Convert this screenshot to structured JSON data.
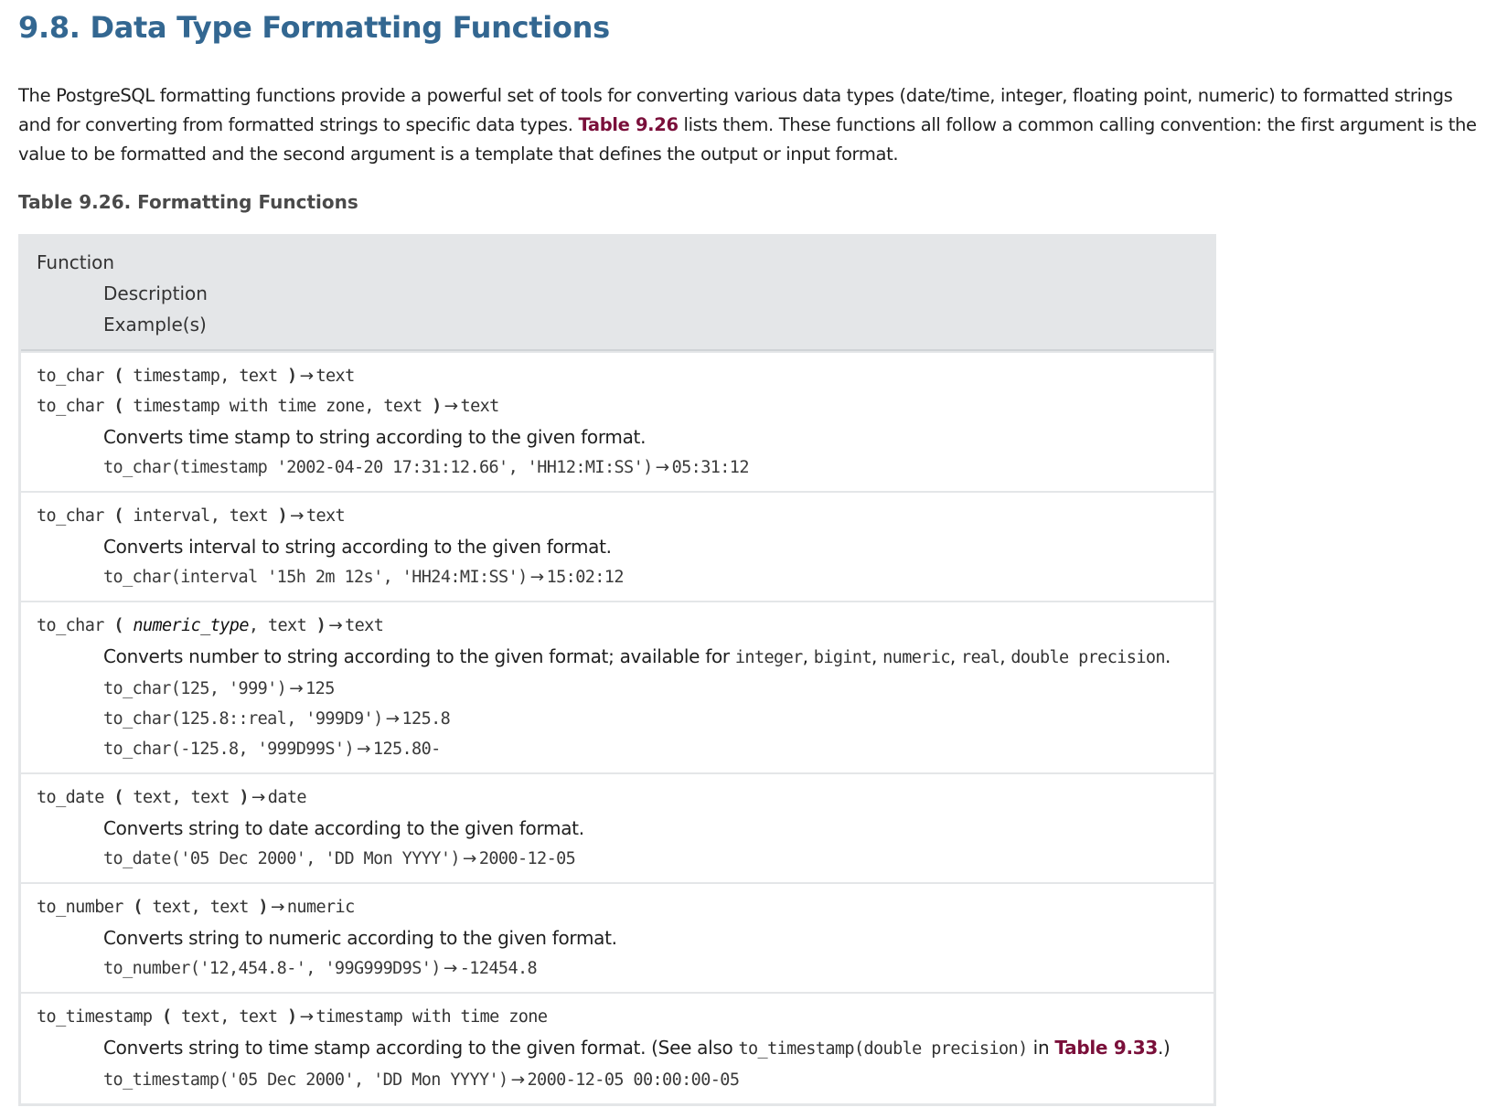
{
  "heading": "9.8. Data Type Formatting Functions",
  "intro": {
    "part1": "The PostgreSQL formatting functions provide a powerful set of tools for converting various data types (date/time, integer, floating point, numeric) to formatted strings and for converting from formatted strings to specific data types. ",
    "link": "Table 9.26",
    "part2": " lists them. These functions all follow a common calling convention: the first argument is the value to be formatted and the second argument is a template that defines the output or input format."
  },
  "table_caption": "Table 9.26. Formatting Functions",
  "header": {
    "function": "Function",
    "description": "Description",
    "examples": "Example(s)"
  },
  "arrow": "→",
  "rows": [
    {
      "sigs": [
        {
          "name": "to_char",
          "open": " ( ",
          "args": "timestamp, text",
          "close": " )",
          "ret": "text"
        },
        {
          "name": "to_char",
          "open": " ( ",
          "args": "timestamp with time zone, text",
          "close": " )",
          "ret": "text"
        }
      ],
      "desc": "Converts time stamp to string according to the given format.",
      "examples": [
        {
          "call": "to_char(timestamp '2002-04-20 17:31:12.66', 'HH12:MI:SS')",
          "result": "05:31:12"
        }
      ]
    },
    {
      "sigs": [
        {
          "name": "to_char",
          "open": " ( ",
          "args": "interval, text",
          "close": " )",
          "ret": "text"
        }
      ],
      "desc": "Converts interval to string according to the given format.",
      "examples": [
        {
          "call": "to_char(interval '15h 2m 12s', 'HH24:MI:SS')",
          "result": "15:02:12"
        }
      ]
    },
    {
      "sigs": [
        {
          "name": "to_char",
          "open": " ( ",
          "placeholder": "numeric_type",
          "args": ", text",
          "close": " )",
          "ret": "text"
        }
      ],
      "desc_text": "Converts number to string according to the given format; available for ",
      "desc_types": [
        "integer",
        "bigint",
        "numeric",
        "real",
        "double precision"
      ],
      "examples": [
        {
          "call": "to_char(125, '999')",
          "result": "125"
        },
        {
          "call": "to_char(125.8::real, '999D9')",
          "result": "125.8"
        },
        {
          "call": "to_char(-125.8, '999D99S')",
          "result": "125.80-"
        }
      ]
    },
    {
      "sigs": [
        {
          "name": "to_date",
          "open": " ( ",
          "args": "text, text",
          "close": " )",
          "ret": "date"
        }
      ],
      "desc": "Converts string to date according to the given format.",
      "examples": [
        {
          "call": "to_date('05 Dec 2000', 'DD Mon YYYY')",
          "result": "2000-12-05"
        }
      ]
    },
    {
      "sigs": [
        {
          "name": "to_number",
          "open": " ( ",
          "args": "text, text",
          "close": " )",
          "ret": "numeric"
        }
      ],
      "desc": "Converts string to numeric according to the given format.",
      "examples": [
        {
          "call": "to_number('12,454.8-', '99G999D9S')",
          "result": "-12454.8"
        }
      ]
    },
    {
      "sigs": [
        {
          "name": "to_timestamp",
          "open": " ( ",
          "args": "text, text",
          "close": " )",
          "ret": "timestamp with time zone"
        }
      ],
      "desc_pre": "Converts string to time stamp according to the given format. (See also ",
      "desc_code": "to_timestamp(double precision)",
      "desc_mid": " in ",
      "desc_link": "Table 9.33",
      "desc_post": ".)",
      "examples": [
        {
          "call": "to_timestamp('05 Dec 2000', 'DD Mon YYYY')",
          "result": "2000-12-05 00:00:00-05"
        }
      ]
    }
  ]
}
